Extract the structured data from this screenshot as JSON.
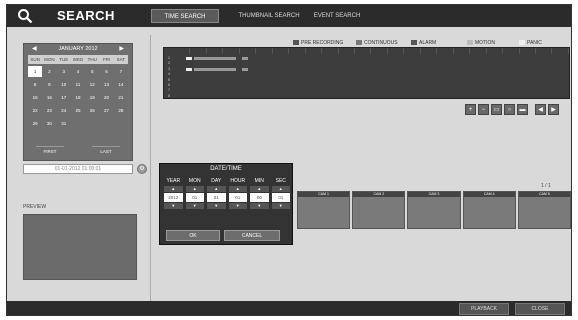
{
  "header": {
    "title": "SEARCH",
    "tabs": [
      {
        "label": "TIME SEARCH",
        "active": true
      },
      {
        "label": "THUMBNAIL SEARCH",
        "active": false
      },
      {
        "label": "EVENT SEARCH",
        "active": false
      }
    ]
  },
  "legend": [
    {
      "label": "PRE RECORDING",
      "color": "#555555"
    },
    {
      "label": "CONTINUOUS",
      "color": "#777777"
    },
    {
      "label": "ALARM",
      "color": "#555555"
    },
    {
      "label": "MOTION",
      "color": "#bbbbbb"
    },
    {
      "label": "PANIC",
      "color": "#eeeeee"
    }
  ],
  "calendar": {
    "month": "JANUARY 2012",
    "days_of_week": [
      "SUN",
      "MON",
      "TUE",
      "WED",
      "THU",
      "FRI",
      "SAT"
    ],
    "days": [
      "1",
      "2",
      "3",
      "4",
      "5",
      "6",
      "7",
      "8",
      "9",
      "10",
      "11",
      "12",
      "13",
      "14",
      "15",
      "16",
      "17",
      "18",
      "19",
      "20",
      "21",
      "22",
      "23",
      "24",
      "25",
      "26",
      "27",
      "28",
      "29",
      "30",
      "31"
    ],
    "first_label": "FIRST",
    "last_label": "LAST"
  },
  "datetime_field": "01-01-2012 01:00:01",
  "preview_label": "PREVIEW",
  "timeline": {
    "channels": [
      "1",
      "2",
      "3",
      "4",
      "5",
      "6",
      "7",
      "8"
    ]
  },
  "datetime_dialog": {
    "title": "DATE/TIME",
    "fields": [
      {
        "label": "YEAR",
        "value": "2012"
      },
      {
        "label": "MON",
        "value": "01"
      },
      {
        "label": "DAY",
        "value": "01"
      },
      {
        "label": "HOUR",
        "value": "01"
      },
      {
        "label": "MIN",
        "value": "00"
      },
      {
        "label": "SEC",
        "value": "01"
      }
    ],
    "ok_label": "OK",
    "cancel_label": "CANCEL"
  },
  "thumbnails": {
    "page_indicator": "1 / 1",
    "items": [
      "CAM 1",
      "CAM 2",
      "CAM 3",
      "CAM 4",
      "CAM 5"
    ]
  },
  "footer": {
    "playback_label": "PLAYBACK",
    "close_label": "CLOSE"
  }
}
